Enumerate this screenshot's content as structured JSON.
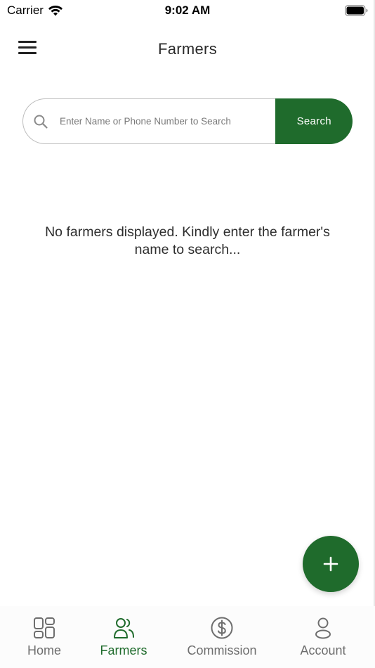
{
  "status_bar": {
    "carrier": "Carrier",
    "time": "9:02 AM",
    "wifi_icon": "wifi-icon",
    "battery_icon": "battery-icon"
  },
  "header": {
    "title": "Farmers",
    "menu_icon": "hamburger-menu-icon"
  },
  "search": {
    "placeholder": "Enter Name or Phone Number to Search",
    "value": "",
    "button_label": "Search",
    "icon": "search-icon"
  },
  "empty_state": {
    "message": "No farmers displayed. Kindly enter the farmer's name to search..."
  },
  "fab": {
    "icon": "plus-icon"
  },
  "bottom_nav": {
    "items": [
      {
        "label": "Home",
        "icon": "grid-icon",
        "active": false
      },
      {
        "label": "Farmers",
        "icon": "users-icon",
        "active": true
      },
      {
        "label": "Commission",
        "icon": "dollar-circle-icon",
        "active": false
      },
      {
        "label": "Account",
        "icon": "user-icon",
        "active": false
      }
    ]
  },
  "colors": {
    "primary_green": "#1f6b2c",
    "inactive_gray": "#6e6e6e",
    "text_dark": "#2e2e2e"
  }
}
